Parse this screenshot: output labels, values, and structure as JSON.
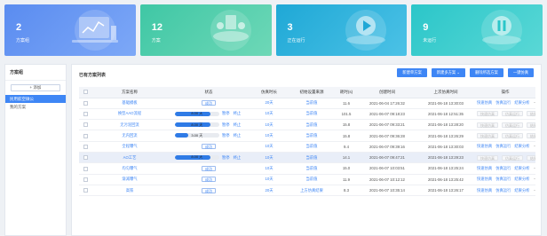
{
  "cards": [
    {
      "value": "2",
      "label": "方案组"
    },
    {
      "value": "12",
      "label": "方案"
    },
    {
      "value": "3",
      "label": "正在运行"
    },
    {
      "value": "9",
      "label": "未运行"
    }
  ],
  "sidebar": {
    "title": "方案组",
    "add_label": "+ 添加",
    "items": [
      {
        "label": "民用航空微公"
      },
      {
        "label": "我的方案"
      }
    ]
  },
  "main": {
    "title": "已有方案列表",
    "buttons": [
      "新建单方案",
      "新建多方案 ⌄",
      "删除所选方案",
      "一键仿真"
    ],
    "columns": [
      "",
      "方案名称",
      "状态",
      "仿真时长",
      "初始设置来源",
      "耗时(s)",
      "创建时间",
      "上次仿真时间",
      "操作"
    ],
    "rows": [
      {
        "name": "基础模板",
        "status_kind": "tag",
        "status": "成功",
        "duration": "20天",
        "source": "当前值",
        "time": "11.6",
        "created": "2021-06-04 17:26:32",
        "last": "2021-06-18 13:30:03",
        "a1": "快速仿真",
        "a2": "仿真运行",
        "a3": "结果分析",
        "a_dim": false
      },
      {
        "name": "换型AAO流程",
        "status_kind": "progress",
        "status": "8.00 天",
        "progress": 0.8,
        "p1": "暂停",
        "p2": "终止",
        "duration": "10天",
        "source": "当前值",
        "time": "101.5",
        "created": "2021-06-07 09:18:23",
        "last": "2021-06-18 12:51:35",
        "a1": "快速仿真",
        "a2": "仿真运行",
        "a3": "结果分析",
        "a_dim": true
      },
      {
        "name": "无污泥回流",
        "status_kind": "progress",
        "status": "8.00 天",
        "progress": 0.8,
        "p1": "暂停",
        "p2": "终止",
        "duration": "10天",
        "source": "当前值",
        "time": "15.8",
        "created": "2021-06-07 09:33:21",
        "last": "2021-06-18 13:28:20",
        "a1": "快速仿真",
        "a2": "仿真运行",
        "a3": "结果分析",
        "a_dim": true
      },
      {
        "name": "无内回流",
        "status_kind": "progress",
        "status": "3.00 天",
        "progress": 0.3,
        "p1": "暂停",
        "p2": "终止",
        "duration": "10天",
        "source": "当前值",
        "time": "15.8",
        "created": "2021-06-07 09:36:28",
        "last": "2021-06-18 13:26:29",
        "a1": "快速仿真",
        "a2": "仿真运行",
        "a3": "结果分析",
        "a_dim": true
      },
      {
        "name": "全程曝气",
        "status_kind": "tag",
        "status": "成功",
        "duration": "10天",
        "source": "当前值",
        "time": "9.4",
        "created": "2021-06-07 09:39:16",
        "last": "2021-06-18 13:30:03",
        "a1": "快速仿真",
        "a2": "仿真运行",
        "a3": "结果分析",
        "a_dim": false
      },
      {
        "name": "AO工艺",
        "status_kind": "progress",
        "status": "8.00 天",
        "progress": 0.8,
        "p1": "暂停",
        "p2": "终止",
        "duration": "10天",
        "source": "当前值",
        "time": "14.1",
        "created": "2021-06-07 09:47:21",
        "last": "2021-06-18 13:29:23",
        "a1": "快速仿真",
        "a2": "仿真运行",
        "a3": "结果分析",
        "a_dim": true
      },
      {
        "name": "均匀曝气",
        "status_kind": "tag",
        "status": "成功",
        "duration": "10天",
        "source": "当前值",
        "time": "15.0",
        "created": "2021-06-07 10:03:51",
        "last": "2021-06-18 13:25:24",
        "a1": "快速仿真",
        "a2": "仿真运行",
        "a3": "结果分析",
        "a_dim": false
      },
      {
        "name": "渐减曝气",
        "status_kind": "tag",
        "status": "成功",
        "duration": "10天",
        "source": "当前值",
        "time": "11.9",
        "created": "2021-06-07 10:12:12",
        "last": "2021-06-18 13:25:42",
        "a1": "快速仿真",
        "a2": "仿真运行",
        "a3": "结果分析",
        "a_dim": false
      },
      {
        "name": "高铁",
        "status_kind": "tag",
        "status": "成功",
        "duration": "20天",
        "source": "上方仿真结果",
        "time": "8.3",
        "created": "2021-06-07 10:35:14",
        "last": "2021-06-18 13:26:17",
        "a1": "快速仿真",
        "a2": "仿真运行",
        "a3": "结果分析",
        "a_dim": false
      }
    ],
    "more": "···"
  }
}
